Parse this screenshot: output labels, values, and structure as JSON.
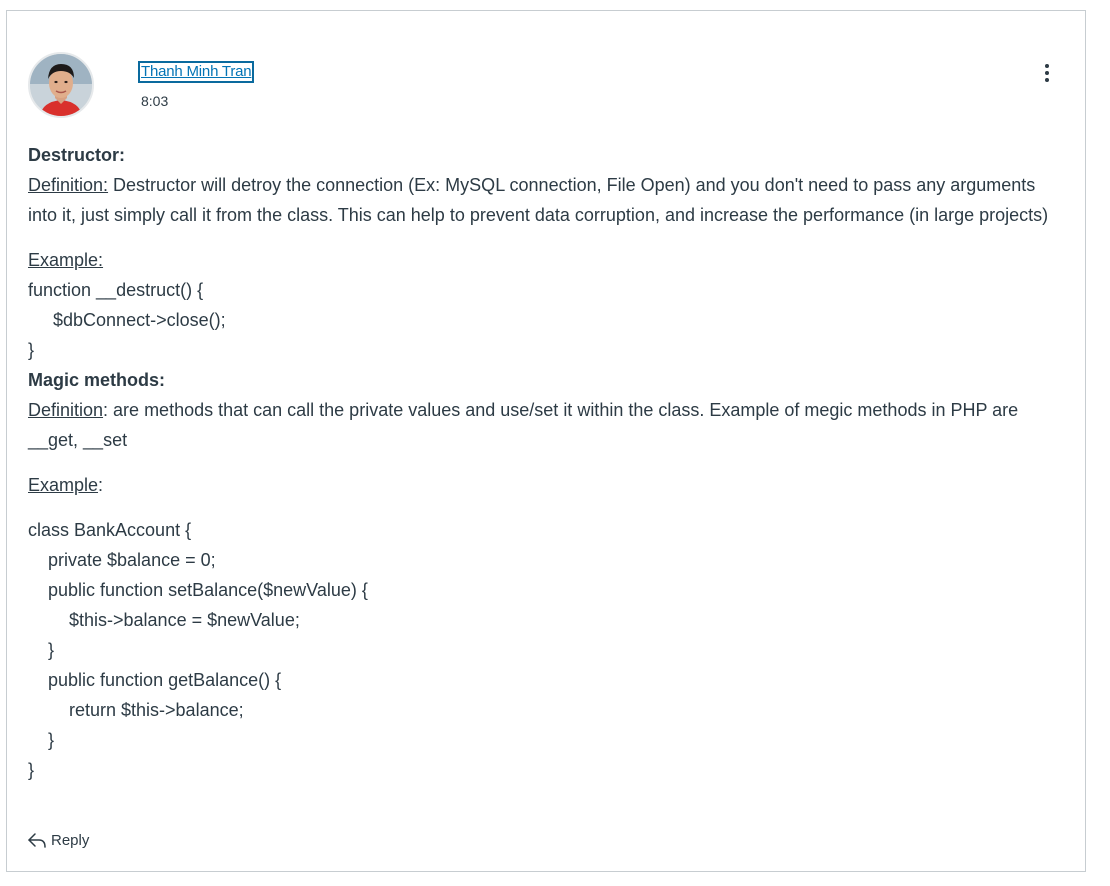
{
  "author": {
    "name": "Thanh Minh Tran",
    "time": "8:03"
  },
  "post": {
    "destructor_heading": "Destructor:",
    "destructor_def_label": "Definition:",
    "destructor_def_text": " Destructor will detroy the connection (Ex: MySQL connection, File Open) and you don't need to pass any arguments into it, just simply call it from the class. This can help to prevent data corruption, and increase the performance (in large projects)",
    "example1_label": "Example:",
    "code1": [
      "function __destruct() {",
      "$dbConnect->close();",
      "}"
    ],
    "magic_heading": "Magic methods:",
    "magic_def_label": "Definition",
    "magic_def_text": ": are methods that can call the private values and use/set it within the class. Example of megic methods in PHP are __get, __set",
    "example2_label": "Example",
    "example2_colon": ":",
    "code2": [
      "class BankAccount {",
      "private $balance = 0;",
      "public function setBalance($newValue) {",
      "$this->balance = $newValue;",
      "}",
      "public function getBalance() {",
      "return $this->balance;",
      "}",
      "}"
    ]
  },
  "actions": {
    "reply_label": "Reply",
    "more_icon": "more-vertical-icon",
    "reply_icon": "reply-arrow-icon"
  }
}
